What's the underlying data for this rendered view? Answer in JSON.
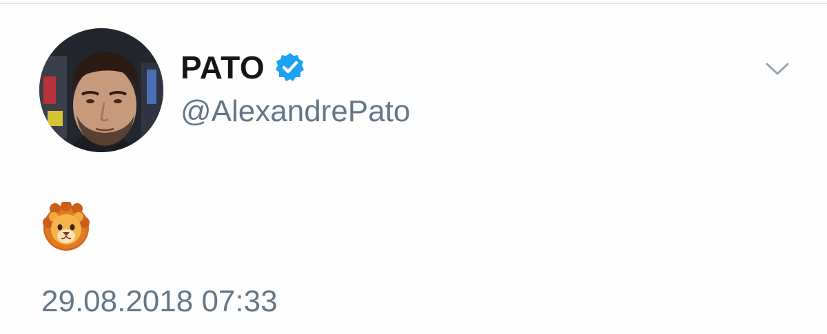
{
  "tweet": {
    "display_name": "PATO",
    "handle": "@AlexandrePato",
    "verified": true,
    "text": "🦁",
    "timestamp": "29.08.2018 07:33"
  },
  "icons": {
    "verified": "verified-badge-icon",
    "menu": "chevron-down-icon",
    "emoji": "lion-face-emoji"
  },
  "colors": {
    "name": "#14171a",
    "secondary_text": "#657786",
    "verified_blue": "#1da1f2",
    "caret": "#9aa4ae",
    "divider": "#e4e6e8"
  }
}
